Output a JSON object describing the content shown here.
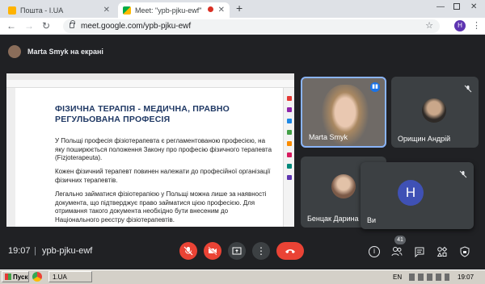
{
  "browser": {
    "tabs": [
      {
        "title": "Пошта - I.UA",
        "active": false
      },
      {
        "title": "Meet: \"ypb-pjku-ewf\"",
        "active": true
      }
    ],
    "new_tab": "+",
    "address": "meet.google.com/ypb-pjku-ewf",
    "profile_initial": "H"
  },
  "meet": {
    "presenting_text": "Marta Smyk на екрані",
    "shared_doc": {
      "title": "ФІЗИЧНА ТЕРАПІЯ - МЕДИЧНА, ПРАВНО РЕГУЛЬОВАНА ПРОФЕСІЯ",
      "paragraphs": [
        "У Польщі професія фізіотерапевта є регламентованою професією, на яку поширюється положення Закону про професію фізичного терапевта (Fizjoterapeuta).",
        "Кожен фізичний терапевт повинен належати до професійної організації фізичних терапевтів.",
        "Легально займатися фізіотерапією у Польщі можна лише за наявності документа, що підтверджує право займатися цією професією. Для отримання такого документа необхідно бути внесеним до Національного реєстру фізіотерапевтів."
      ]
    },
    "participants": [
      {
        "name": "Marta Smyk",
        "speaking": true
      },
      {
        "name": "Орищин Андрій",
        "muted": true
      },
      {
        "name": "Бенцак Дарина",
        "muted": true
      },
      {
        "name": "Ви",
        "initial": "H",
        "muted": true
      }
    ],
    "time": "19:07",
    "separator": "|",
    "meeting_code": "ypb-pjku-ewf",
    "participants_count": "41"
  },
  "taskbar": {
    "start_label": "Пуск",
    "item_label": "1.UA",
    "lang": "EN",
    "clock": "19:07"
  },
  "colors": {
    "meet_bg": "#202124",
    "red_button": "#ea4335",
    "dark_button": "#3c4043",
    "accent_blue": "#8ab4f8",
    "avatar_indigo": "#3f51b5"
  }
}
